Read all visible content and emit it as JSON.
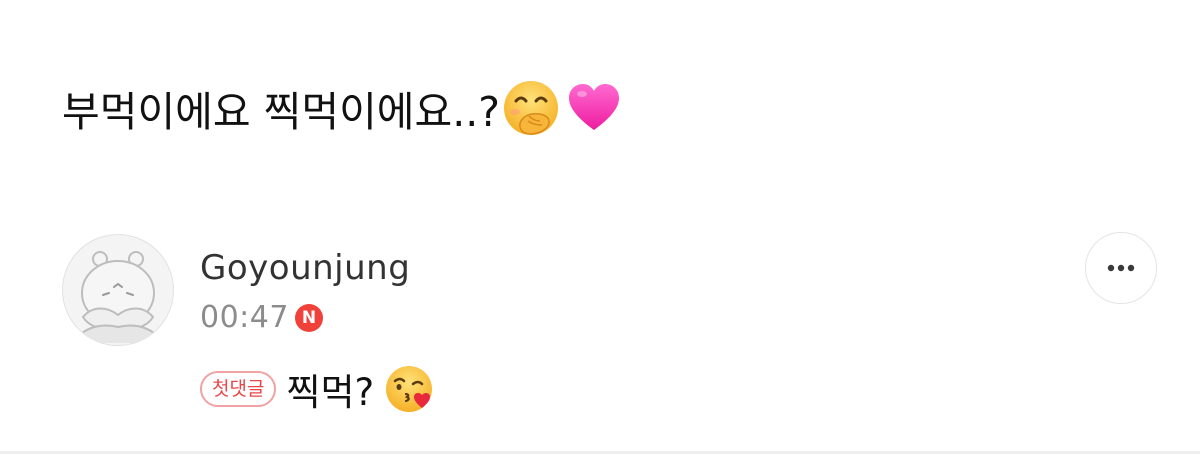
{
  "post": {
    "text": "부먹이에요 찍먹이에요..?",
    "emojis": [
      "face-with-hand-over-mouth",
      "pink-heart"
    ]
  },
  "comment": {
    "author": "Goyounjung",
    "time": "00:47",
    "new_badge": "N",
    "first_comment_badge": "첫댓글",
    "text": "찍먹?",
    "emoji": "face-blowing-a-kiss",
    "avatar_icon": "hippo-character-avatar",
    "more_icon": "more-options-icon"
  },
  "colors": {
    "new_badge": "#f0413a",
    "first_badge_text": "#e8474a",
    "first_badge_border": "#f1a2a3",
    "heart": "#ff3fb7",
    "emoji_yellow": "#ffcb3d"
  }
}
